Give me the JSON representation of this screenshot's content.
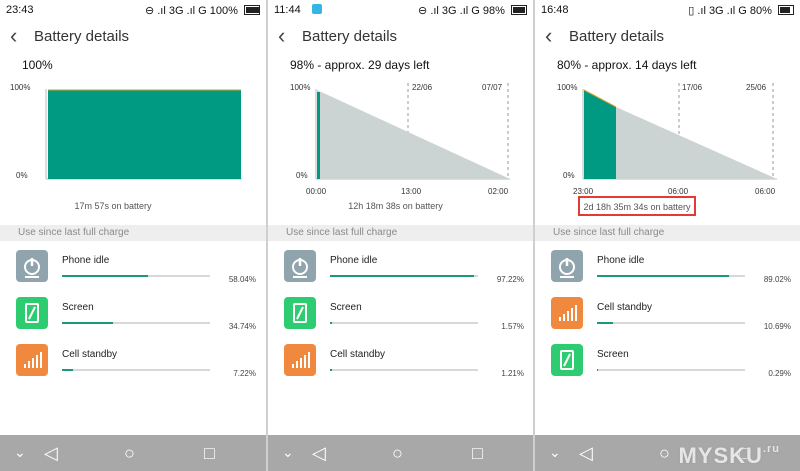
{
  "screens": [
    {
      "status": {
        "time": "23:43",
        "icons": "⊖ .ıl 3G .ıl G",
        "battery": "100%"
      },
      "title": "Battery details",
      "headline": "100%",
      "chart": {
        "y_top": "100%",
        "y_bottom": "0%",
        "x_labels": [],
        "markers": []
      },
      "on_battery": "17m 57s on battery",
      "section": "Use since last full charge",
      "items": [
        {
          "label": "Phone idle",
          "value": "58.04%",
          "fraction": 0.5804,
          "icon": "power-icon"
        },
        {
          "label": "Screen",
          "value": "34.74%",
          "fraction": 0.3474,
          "icon": "phone-screen-icon"
        },
        {
          "label": "Cell standby",
          "value": "7.22%",
          "fraction": 0.0722,
          "icon": "signal-bars-icon"
        }
      ]
    },
    {
      "status": {
        "time": "11:44",
        "icons": "⊖ .ıl 3G .ıl G",
        "battery": "98%"
      },
      "title": "Battery details",
      "headline": "98% - approx. 29 days left",
      "chart": {
        "y_top": "100%",
        "y_bottom": "0%",
        "x_labels": [
          "00:00",
          "13:00",
          "02:00"
        ],
        "markers": [
          "22/06",
          "07/07"
        ]
      },
      "on_battery": "12h 18m 38s on battery",
      "section": "Use since last full charge",
      "items": [
        {
          "label": "Phone idle",
          "value": "97.22%",
          "fraction": 0.9722,
          "icon": "power-icon"
        },
        {
          "label": "Screen",
          "value": "1.57%",
          "fraction": 0.0157,
          "icon": "phone-screen-icon"
        },
        {
          "label": "Cell standby",
          "value": "1.21%",
          "fraction": 0.0121,
          "icon": "signal-bars-icon"
        }
      ]
    },
    {
      "status": {
        "time": "16:48",
        "icons": "▯ .ıl 3G .ıl G",
        "battery": "80%"
      },
      "title": "Battery details",
      "headline": "80% - approx. 14 days left",
      "chart": {
        "y_top": "100%",
        "y_bottom": "0%",
        "x_labels": [
          "23:00",
          "06:00",
          "06:00"
        ],
        "markers": [
          "17/06",
          "25/06"
        ]
      },
      "on_battery": "2d 18h 35m 34s on battery",
      "section": "Use since last full charge",
      "items": [
        {
          "label": "Phone idle",
          "value": "89.02%",
          "fraction": 0.8902,
          "icon": "power-icon"
        },
        {
          "label": "Cell standby",
          "value": "10.69%",
          "fraction": 0.1069,
          "icon": "signal-bars-icon"
        },
        {
          "label": "Screen",
          "value": "0.29%",
          "fraction": 0.0029,
          "icon": "phone-screen-icon"
        }
      ]
    }
  ],
  "colors": {
    "accent": "#1a9a7a",
    "bar_fill": "#009a82",
    "projection": "#ccd3d3",
    "highlight_box": "#e53935"
  },
  "watermark": {
    "text": "MYSKU",
    "suffix": ".ru"
  }
}
